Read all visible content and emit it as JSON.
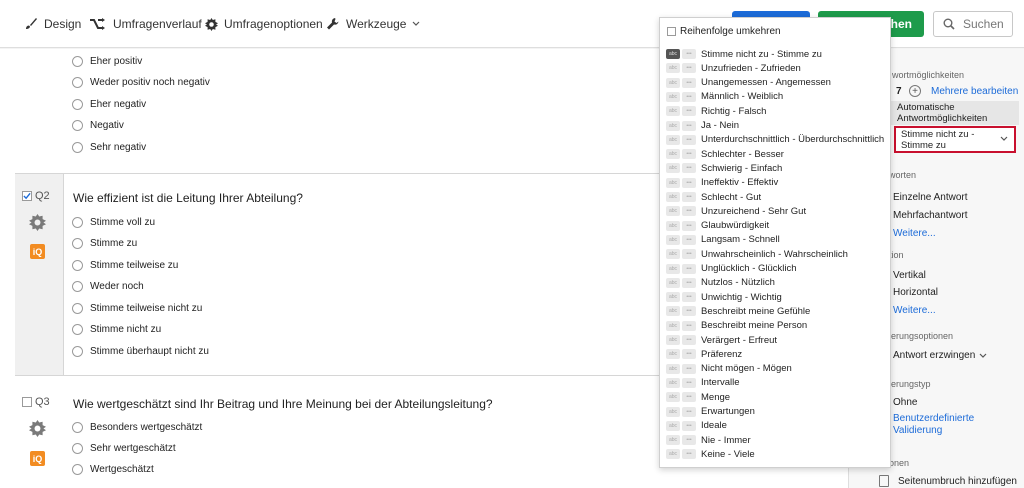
{
  "toolbar": {
    "design": "Design",
    "history": "Umfragenverlauf",
    "options": "Umfragenoptionen",
    "tools": "Werkzeuge",
    "publish_tail": "chen",
    "search_placeholder": "Suchen"
  },
  "q1": {
    "choices": [
      "Eher positiv",
      "Weder positiv noch negativ",
      "Eher negativ",
      "Negativ",
      "Sehr negativ"
    ]
  },
  "q2": {
    "label": "Q2",
    "text": "Wie effizient ist die Leitung Ihrer Abteilung?",
    "choices": [
      "Stimme voll zu",
      "Stimme zu",
      "Stimme teilweise zu",
      "Weder noch",
      "Stimme teilweise nicht zu",
      "Stimme nicht zu",
      "Stimme überhaupt nicht zu"
    ]
  },
  "q3": {
    "label": "Q3",
    "text": "Wie wertgeschätzt sind Ihr Beitrag und Ihre Meinung bei der Abteilungsleitung?",
    "choices": [
      "Besonders wertgeschätzt",
      "Sehr wertgeschätzt",
      "Wertgeschätzt"
    ]
  },
  "iq_badge": "iQ",
  "dropdown": {
    "reverse_label": "Reihenfolge umkehren",
    "pill_a": "abc",
    "pill_b": "•••",
    "items": [
      "Stimme nicht zu - Stimme zu",
      "Unzufrieden - Zufrieden",
      "Unangemessen - Angemessen",
      "Männlich - Weiblich",
      "Richtig - Falsch",
      "Ja - Nein",
      "Unterdurchschnittlich - Überdurchschnittlich",
      "Schlechter - Besser",
      "Schwierig - Einfach",
      "Ineffektiv - Effektiv",
      "Schlecht - Gut",
      "Unzureichend - Sehr Gut",
      "Glaubwürdigkeit",
      "Langsam - Schnell",
      "Unwahrscheinlich - Wahrscheinlich",
      "Unglücklich - Glücklich",
      "Nutzlos - Nützlich",
      "Unwichtig - Wichtig",
      "Beschreibt meine Gefühle",
      "Beschreibt meine Person",
      "Verärgert - Erfreut",
      "Präferenz",
      "Nicht mögen - Mögen",
      "Intervalle",
      "Menge",
      "Erwartungen",
      "Ideale",
      "Nie - Immer",
      "Keine - Viele"
    ]
  },
  "rpanel": {
    "answer_choices_head": "wortmöglichkeiten",
    "count": "7",
    "edit_multiple": "Mehrere bearbeiten",
    "auto_choices": "Automatische Antwortmöglichkeiten",
    "selected_scale": "Stimme nicht zu - Stimme zu",
    "answers_head": "worten",
    "single": "Einzelne Antwort",
    "multiple": "Mehrfachantwort",
    "more1": "Weitere...",
    "position_head": "tion",
    "vertical": "Vertikal",
    "horizontal": "Horizontal",
    "more2": "Weitere...",
    "validation_opts_head": "ierungsoptionen",
    "force_response": "Antwort erzwingen",
    "validation_type_head": "ierungstyp",
    "none": "Ohne",
    "custom_validation": "Benutzerdefinierte Validierung",
    "actions_head": "onen",
    "page_break": "Seitenumbruch hinzufügen"
  },
  "colors": {
    "accent_blue": "#1c6bd8",
    "publish_green": "#1e9b4b",
    "iq_orange": "#f28c22",
    "highlight_red": "#c8102e"
  }
}
